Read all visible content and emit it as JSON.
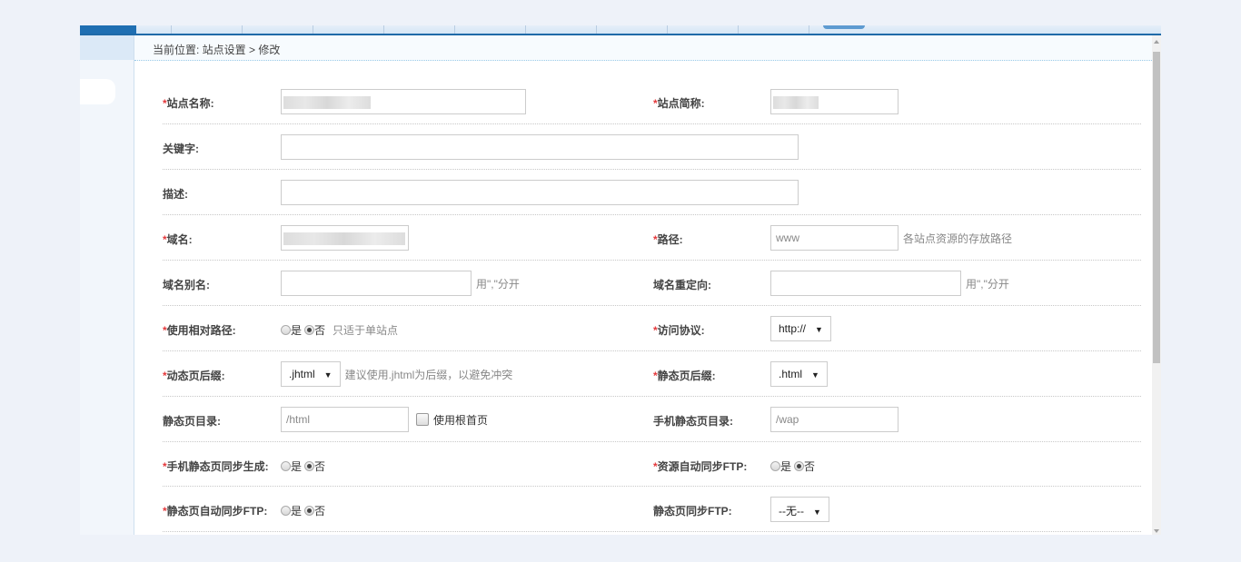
{
  "breadcrumb": "当前位置: 站点设置 > 修改",
  "rows": {
    "site_name": {
      "label": "站点名称:"
    },
    "site_short": {
      "label": "站点简称:"
    },
    "keywords": {
      "label": "关键字:",
      "value": ""
    },
    "description": {
      "label": "描述:",
      "value": ""
    },
    "domain": {
      "label": "域名:"
    },
    "path": {
      "label": "路径:",
      "value": "www",
      "hint": "各站点资源的存放路径"
    },
    "domain_alias": {
      "label": "域名别名:",
      "value": "",
      "hint": "用\",\"分开"
    },
    "domain_redirect": {
      "label": "域名重定向:",
      "value": "",
      "hint": "用\",\"分开"
    },
    "relative_path": {
      "label": "使用相对路径:",
      "yes": "是",
      "no": "否",
      "hint": "只适于单站点"
    },
    "protocol": {
      "label": "访问协议:",
      "value": "http://"
    },
    "dynamic_suffix": {
      "label": "动态页后缀:",
      "value": ".jhtml",
      "hint": "建议使用.jhtml为后缀，以避免冲突"
    },
    "static_suffix": {
      "label": "静态页后缀:",
      "value": ".html"
    },
    "static_dir": {
      "label": "静态页目录:",
      "value": "/html",
      "checkbox": "使用根首页"
    },
    "mobile_static_dir": {
      "label": "手机静态页目录:",
      "value": "/wap"
    },
    "mobile_sync": {
      "label": "手机静态页同步生成:",
      "yes": "是",
      "no": "否"
    },
    "res_ftp": {
      "label": "资源自动同步FTP:",
      "yes": "是",
      "no": "否"
    },
    "static_ftp_auto": {
      "label": "静态页自动同步FTP:",
      "yes": "是",
      "no": "否"
    },
    "static_ftp": {
      "label": "静态页同步FTP:",
      "value": "--无--"
    }
  },
  "required_mark": "*"
}
